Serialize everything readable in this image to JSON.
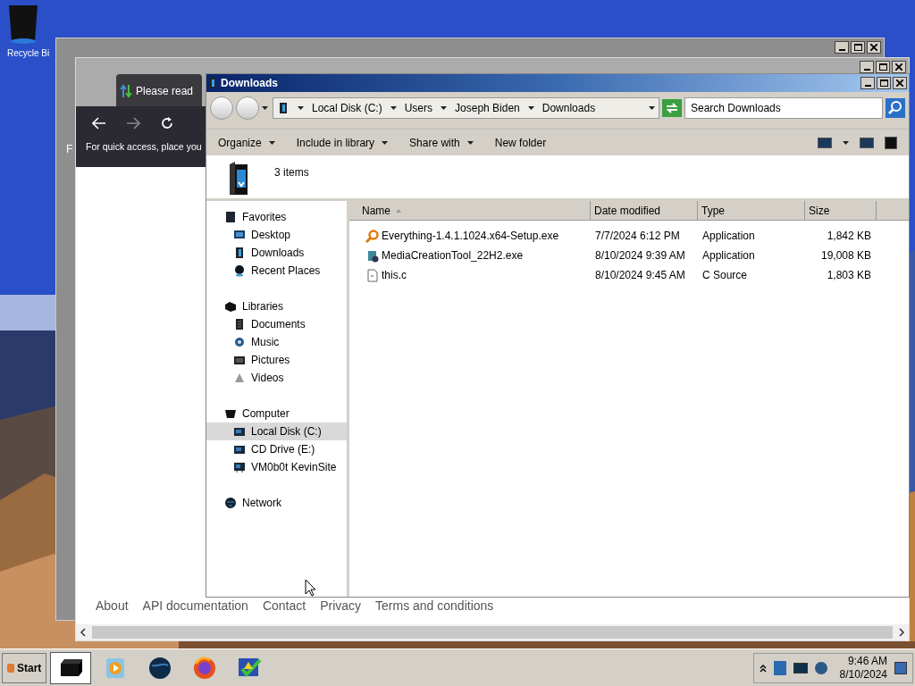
{
  "desktop_icons": [
    {
      "label": "Recycle Bi"
    }
  ],
  "back_window": {
    "text": "F"
  },
  "browser": {
    "tab_title": "Please read",
    "hint": "For quick access, place you",
    "footer_links": [
      "About",
      "API documentation",
      "Contact",
      "Privacy",
      "Terms and conditions"
    ]
  },
  "explorer": {
    "title": "Downloads",
    "breadcrumb": [
      "Local Disk (C:)",
      "Users",
      "Joseph Biden",
      "Downloads"
    ],
    "search": {
      "placeholder": "Search Downloads"
    },
    "commands": [
      {
        "label": "Organize",
        "dropdown": true
      },
      {
        "label": "Include in library",
        "dropdown": true
      },
      {
        "label": "Share with",
        "dropdown": true
      },
      {
        "label": "New folder",
        "dropdown": false
      }
    ],
    "details": "3 items",
    "nav": [
      {
        "label": "Favorites",
        "kind": "favorites",
        "selected": false,
        "children": [
          {
            "label": "Desktop",
            "kind": "desktop",
            "selected": false
          },
          {
            "label": "Downloads",
            "kind": "downloads",
            "selected": false
          },
          {
            "label": "Recent Places",
            "kind": "recent",
            "selected": false
          }
        ]
      },
      {
        "label": "Libraries",
        "kind": "libraries",
        "selected": false,
        "children": [
          {
            "label": "Documents",
            "kind": "documents",
            "selected": false
          },
          {
            "label": "Music",
            "kind": "music",
            "selected": false
          },
          {
            "label": "Pictures",
            "kind": "pictures",
            "selected": false
          },
          {
            "label": "Videos",
            "kind": "videos",
            "selected": false
          }
        ]
      },
      {
        "label": "Computer",
        "kind": "computer",
        "selected": false,
        "children": [
          {
            "label": "Local Disk (C:)",
            "kind": "drive",
            "selected": true
          },
          {
            "label": "CD Drive (E:)",
            "kind": "drive",
            "selected": false
          },
          {
            "label": "VM0b0t KevinSite",
            "kind": "netdrive",
            "selected": false
          }
        ]
      },
      {
        "label": "Network",
        "kind": "network",
        "selected": false
      }
    ],
    "columns": [
      {
        "label": "Name",
        "sorted": true
      },
      {
        "label": "Date modified",
        "sorted": false
      },
      {
        "label": "Type",
        "sorted": false
      },
      {
        "label": "Size",
        "sorted": false
      }
    ],
    "rows": [
      {
        "kind": "search",
        "name": "Everything-1.4.1.1024.x64-Setup.exe",
        "date": "7/7/2024 6:12 PM",
        "type": "Application",
        "size": "1,842 KB"
      },
      {
        "kind": "installer",
        "name": "MediaCreationTool_22H2.exe",
        "date": "8/10/2024 9:39 AM",
        "type": "Application",
        "size": "19,008 KB"
      },
      {
        "kind": "text",
        "name": "this.c",
        "date": "8/10/2024 9:45 AM",
        "type": "C Source",
        "size": "1,803 KB"
      }
    ]
  },
  "taskbar": {
    "start": "Start",
    "apps": [
      {
        "kind": "explorer",
        "selected": true
      },
      {
        "kind": "media",
        "selected": false
      },
      {
        "kind": "globe",
        "selected": false
      },
      {
        "kind": "firefox",
        "selected": false
      },
      {
        "kind": "check",
        "selected": false
      }
    ],
    "time": "9:46 AM",
    "date": "8/10/2024"
  }
}
